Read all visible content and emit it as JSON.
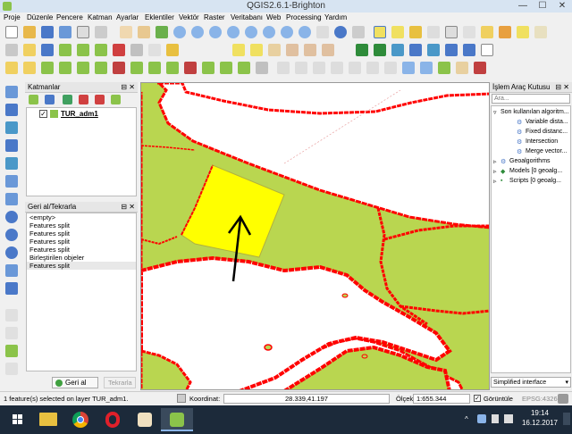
{
  "window": {
    "title": "QGIS2.6.1-Brighton"
  },
  "menu": [
    "Proje",
    "Düzenle",
    "Pencere",
    "Katman",
    "Ayarlar",
    "Eklentiler",
    "Vektör",
    "Raster",
    "Veritabanı",
    "Web",
    "Processing",
    "Yardım"
  ],
  "layers_panel": {
    "title": "Katmanlar",
    "layer_name": "TUR_adm1",
    "layer_checked": true
  },
  "undo_panel": {
    "title": "Geri al/Tekrarla",
    "items": [
      "<empty>",
      "Features split",
      "Features split",
      "Features split",
      "Features split",
      "Birleştirilen objeler",
      "Features split"
    ],
    "selected_index": 6,
    "undo_label": "Geri al",
    "redo_label": "Tekrarla"
  },
  "processing_panel": {
    "title": "İşlem Araç Kutusu",
    "search_placeholder": "Ara...",
    "tree": {
      "root": "Son kullanılan algoritm...",
      "children": [
        "Variable dista...",
        "Fixed distanc...",
        "Intersection",
        "Merge vector..."
      ],
      "groups": [
        "Geoalgorithms",
        "Models [0 geoalg...",
        "Scripts [0 geoalg..."
      ]
    },
    "interface_option": "Simplified interface"
  },
  "status": {
    "message": "1 feature(s) selected on layer TUR_adm1.",
    "coord_label": "Koordinat:",
    "coord_value": "28.339,41.197",
    "scale_label": "Ölçek",
    "scale_value": "1:655.344",
    "render_label": "Görüntüle",
    "crs": "EPSG:4326"
  },
  "taskbar": {
    "time": "19:14",
    "date": "16.12.2017"
  },
  "colors": {
    "land": "#b9d650",
    "border": "#ff0000",
    "selected": "#ffff00",
    "water": "#ffffff"
  }
}
